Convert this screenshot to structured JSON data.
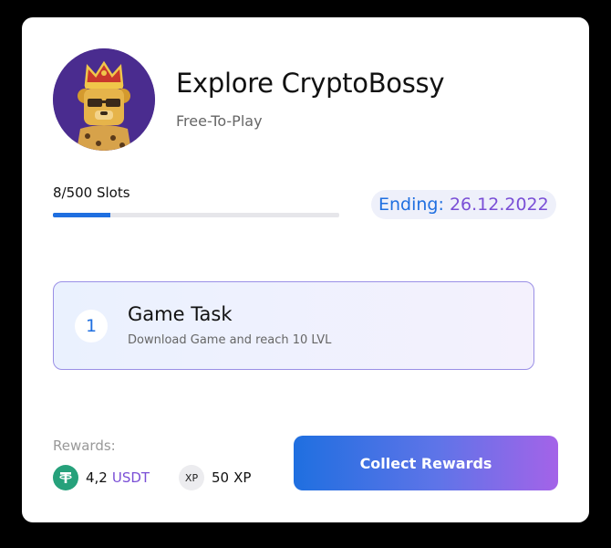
{
  "game": {
    "title": "Explore CryptoBossy",
    "subtitle": "Free-To-Play",
    "avatar_icon": "crowned-bear-icon"
  },
  "slots": {
    "label": "8/500 Slots",
    "filled": 8,
    "total": 500,
    "progress_fraction": 0.2
  },
  "ending": {
    "label": "Ending:",
    "date": "26.12.2022"
  },
  "task": {
    "number": "1",
    "title": "Game Task",
    "description": "Download Game and reach 10 LVL"
  },
  "rewards": {
    "label": "Rewards:",
    "items": [
      {
        "icon": "tether-icon",
        "amount": "4,2",
        "unit": "USDT"
      },
      {
        "icon": "xp-icon",
        "icon_text": "XP",
        "amount": "50",
        "unit": "XP"
      }
    ]
  },
  "collect_button": {
    "label": "Collect Rewards"
  },
  "colors": {
    "accent_blue": "#1f6fe0",
    "accent_purple": "#7a4fd6",
    "tether_green": "#26a17b"
  }
}
